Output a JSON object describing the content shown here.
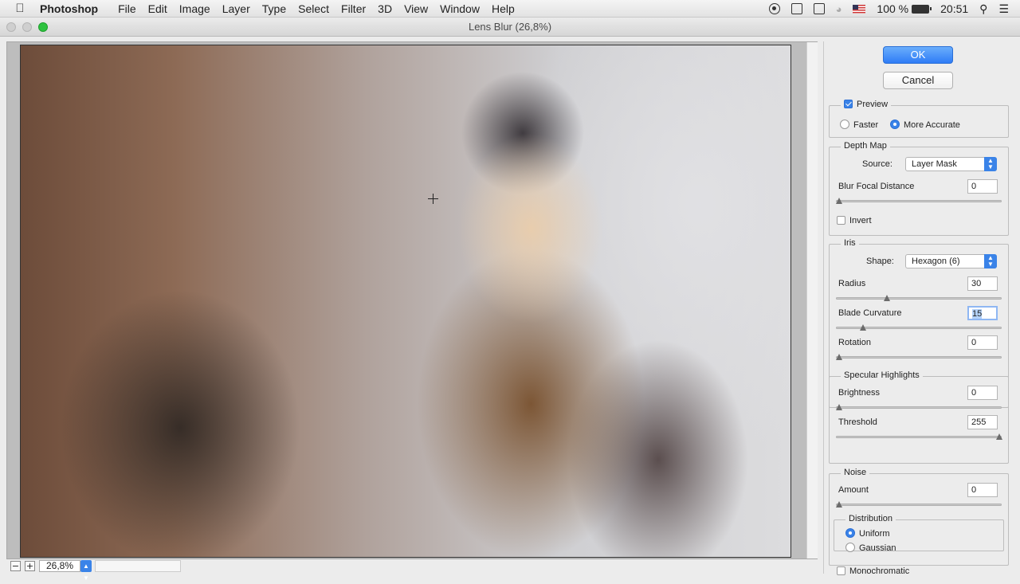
{
  "menubar": {
    "app_name": "Photoshop",
    "items": [
      "File",
      "Edit",
      "Image",
      "Layer",
      "Type",
      "Select",
      "Filter",
      "3D",
      "View",
      "Window",
      "Help"
    ],
    "battery": "100 %",
    "clock": "20:51"
  },
  "window": {
    "title": "Lens Blur (26,8%)"
  },
  "zoom": {
    "value": "26,8%",
    "minus": "−",
    "plus": "+"
  },
  "buttons": {
    "ok": "OK",
    "cancel": "Cancel"
  },
  "preview": {
    "label": "Preview",
    "checked": true,
    "faster": "Faster",
    "more_accurate": "More Accurate",
    "selected": "More Accurate"
  },
  "depth_map": {
    "legend": "Depth Map",
    "source_label": "Source:",
    "source_value": "Layer Mask",
    "focal_label": "Blur Focal Distance",
    "focal_value": "0",
    "invert_label": "Invert"
  },
  "iris": {
    "legend": "Iris",
    "shape_label": "Shape:",
    "shape_value": "Hexagon (6)",
    "radius_label": "Radius",
    "radius_value": "30",
    "curvature_label": "Blade Curvature",
    "curvature_value": "15",
    "rotation_label": "Rotation",
    "rotation_value": "0"
  },
  "specular": {
    "legend": "Specular Highlights",
    "brightness_label": "Brightness",
    "brightness_value": "0",
    "threshold_label": "Threshold",
    "threshold_value": "255"
  },
  "noise": {
    "legend": "Noise",
    "amount_label": "Amount",
    "amount_value": "0",
    "distribution_legend": "Distribution",
    "uniform": "Uniform",
    "gaussian": "Gaussian",
    "selected": "Uniform",
    "mono_label": "Monochromatic"
  },
  "colors": {
    "accent": "#3a83e8"
  }
}
